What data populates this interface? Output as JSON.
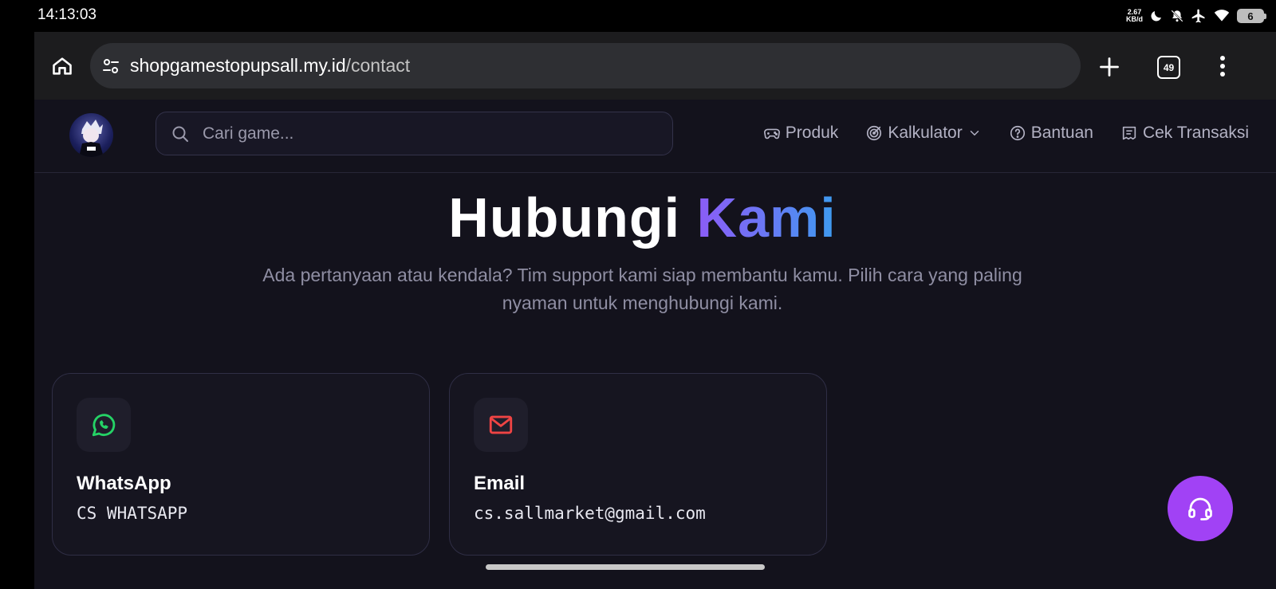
{
  "status": {
    "time": "14:13:03",
    "net_speed_value": "2.67",
    "net_speed_unit": "KB/d",
    "battery": "6"
  },
  "browser": {
    "url_domain": "shopgamestopupsall.my.id",
    "url_path": "/contact",
    "tab_count": "49"
  },
  "nav": {
    "search_placeholder": "Cari game...",
    "links": [
      {
        "label": "Produk",
        "icon": "gamepad-icon"
      },
      {
        "label": "Kalkulator",
        "icon": "target-icon"
      },
      {
        "label": "Bantuan",
        "icon": "help-circle-icon"
      },
      {
        "label": "Cek Transaksi",
        "icon": "receipt-icon"
      }
    ]
  },
  "hero": {
    "title_plain": "Hubungi ",
    "title_accent": "Kami",
    "subtitle": "Ada pertanyaan atau kendala? Tim support kami siap membantu kamu. Pilih cara yang paling nyaman untuk menghubungi kami."
  },
  "contacts": [
    {
      "title": "WhatsApp",
      "value": "CS WHATSAPP",
      "icon": "whatsapp-icon",
      "color": "#25d366"
    },
    {
      "title": "Email",
      "value": "cs.sallmarket@gmail.com",
      "icon": "mail-icon",
      "color": "#ef4444"
    }
  ],
  "colors": {
    "page_bg": "#13121c",
    "accent_start": "#8b5cf6",
    "accent_end": "#3d9cf0",
    "fab": "#a142f5"
  }
}
